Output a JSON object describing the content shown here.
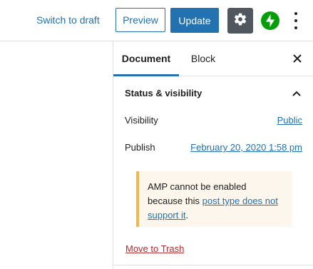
{
  "toolbar": {
    "switch_to_draft": "Switch to draft",
    "preview": "Preview",
    "update": "Update",
    "settings_icon": "gear-icon",
    "jetpack_icon": "jetpack-lightning-icon",
    "more_icon": "vertical-ellipsis-icon"
  },
  "sidebar": {
    "tabs": [
      {
        "label": "Document",
        "active": true
      },
      {
        "label": "Block",
        "active": false
      }
    ],
    "close_icon": "close-icon",
    "panel": {
      "title": "Status & visibility",
      "expanded": true,
      "rows": [
        {
          "label": "Visibility",
          "value": "Public"
        },
        {
          "label": "Publish",
          "value": "February 20, 2020 1:58 pm"
        }
      ],
      "notice": {
        "text_before": "AMP cannot be enabled because this ",
        "link": "post type does not support it",
        "text_after": "."
      },
      "trash_link": "Move to Trash"
    }
  },
  "colors": {
    "accent": "#2271b1",
    "settings_bg": "#50575e",
    "jetpack_green": "#069e08",
    "danger": "#b32d2e",
    "notice_border": "#f0b849",
    "notice_bg": "#fcf6ec"
  }
}
